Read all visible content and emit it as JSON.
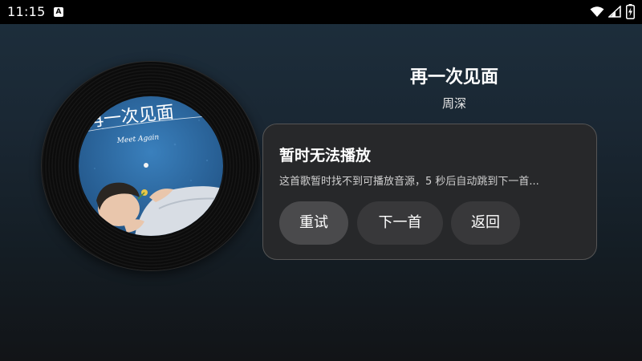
{
  "status_bar": {
    "time": "11:15",
    "notification_badge": "A",
    "icons": [
      "wifi-icon",
      "signal-icon",
      "battery-icon"
    ]
  },
  "player": {
    "title": "再一次见面",
    "artist": "周深",
    "album_art": {
      "title_text": "再一次见面",
      "subtitle_text": "Meet Again"
    }
  },
  "dialog": {
    "title": "暂时无法播放",
    "message": "这首歌暂时找不到可播放音源，5 秒后自动跳到下一首...",
    "buttons": {
      "retry": "重试",
      "next": "下一首",
      "back": "返回"
    }
  },
  "colors": {
    "background": "#1a2733",
    "dialog_background": "#28282a",
    "button_primary": "#4a4a4c",
    "button_secondary": "#38383a",
    "album_blue": "#2f6ea8"
  }
}
